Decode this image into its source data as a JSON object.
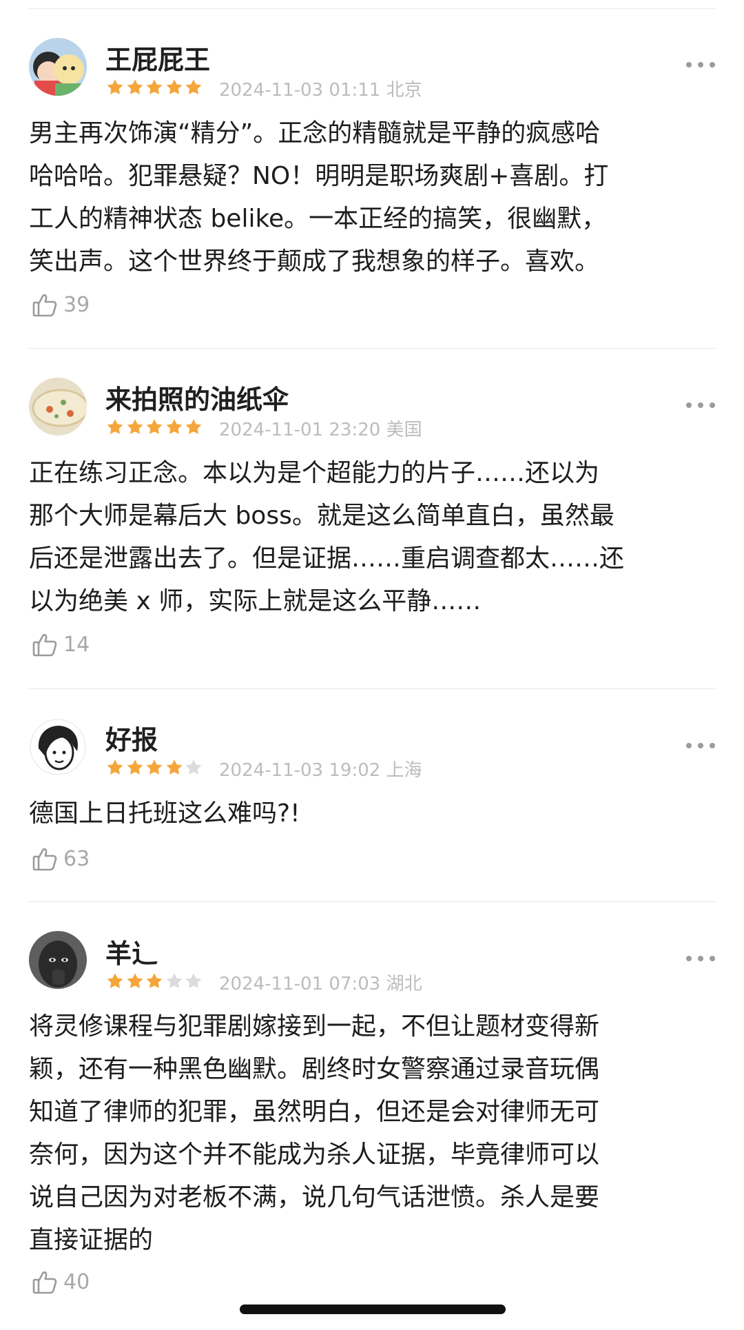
{
  "reviews": [
    {
      "username": "王屁屁王",
      "rating": 5,
      "max_rating": 5,
      "datetime": "2024-11-03 01:11",
      "location": "北京",
      "content_lines": [
        "男主再次饰演“精分”。正念的精髓就是平静的疯感哈",
        "哈哈哈。犯罪悬疑？NO！明明是职场爽剧+喜剧。打",
        "工人的精神状态 belike。一本正经的搞笑，很幽默，",
        "笑出声。这个世界终于颠成了我想象的样子。喜欢。"
      ],
      "likes": "39",
      "avatar": "cartoon-kids-avatar"
    },
    {
      "username": "来拍照的油纸伞",
      "rating": 5,
      "max_rating": 5,
      "datetime": "2024-11-01 23:20",
      "location": "美国",
      "content_lines": [
        "正在练习正念。本以为是个超能力的片子……还以为",
        "那个大师是幕后大 boss。就是这么简单直白，虽然最",
        "后还是泄露出去了。但是证据……重启调查都太……还",
        "以为绝美 x 师，实际上就是这么平静……"
      ],
      "likes": "14",
      "avatar": "food-plate-avatar"
    },
    {
      "username": "好报",
      "rating": 4,
      "max_rating": 5,
      "datetime": "2024-11-03 19:02",
      "location": "上海",
      "content_lines": [
        "德国上日托班这么难吗?!"
      ],
      "likes": "63",
      "avatar": "face-sketch-avatar"
    },
    {
      "username": "羊辶",
      "rating": 3,
      "max_rating": 5,
      "datetime": "2024-11-01 07:03",
      "location": "湖北",
      "content_lines": [
        "将灵修课程与犯罪剧嫁接到一起，不但让题材变得新",
        "颖，还有一种黑色幽默。剧终时女警察通过录音玩偶",
        "知道了律师的犯罪，虽然明白，但还是会对律师无可",
        "奈何，因为这个并不能成为杀人证据，毕竟律师可以",
        "说自己因为对老板不满，说几句气话泄愤。杀人是要",
        "直接证据的"
      ],
      "likes": "40",
      "avatar": "dark-photo-avatar"
    }
  ],
  "icons": {
    "star": "star-icon",
    "like": "thumbs-up-icon",
    "more": "more-dots-icon"
  },
  "colors": {
    "star_filled": "#f4a63a",
    "star_empty": "#dcdcdc",
    "meta_text": "#bcbcbc",
    "like_text": "#a8a8a8"
  }
}
